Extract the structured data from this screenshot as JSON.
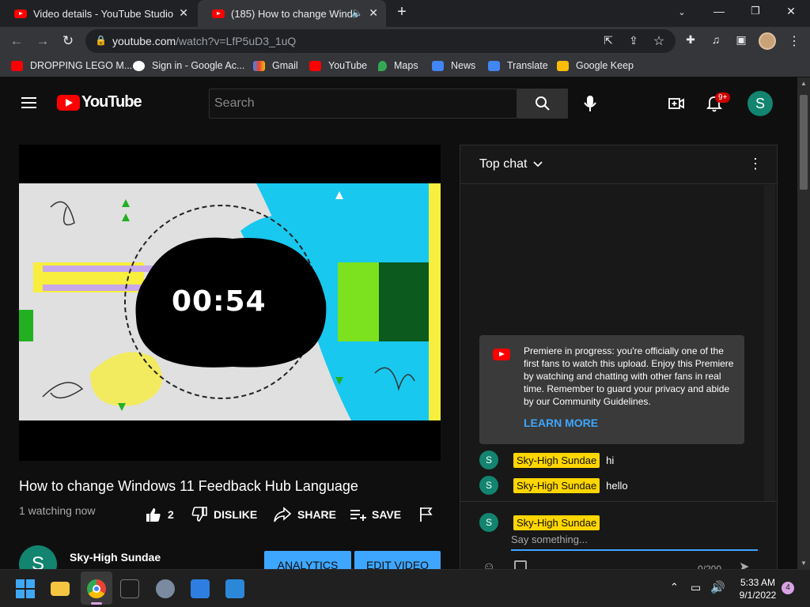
{
  "browser": {
    "tabs": [
      {
        "title": "Video details - YouTube Studio",
        "active": false
      },
      {
        "title": "(185) How to change Windo",
        "active": true
      }
    ],
    "url_host": "youtube.com",
    "url_path": "/watch?v=LfP5uD3_1uQ",
    "bookmarks": [
      "DROPPING LEGO M...",
      "Sign in - Google Ac...",
      "Gmail",
      "YouTube",
      "Maps",
      "News",
      "Translate",
      "Google Keep"
    ]
  },
  "youtube": {
    "logo_text": "YouTube",
    "search_placeholder": "Search",
    "notification_badge": "9+",
    "user_initial": "S"
  },
  "video": {
    "countdown": "00:54",
    "title": "How to change Windows 11 Feedback Hub Language",
    "watching": "1 watching now",
    "like_count": "2",
    "dislike_label": "DISLIKE",
    "share_label": "SHARE",
    "save_label": "SAVE",
    "channel_name": "Sky-High Sundae",
    "channel_initial": "S",
    "analytics_label": "ANALYTICS",
    "edit_label": "EDIT VIDEO"
  },
  "chat": {
    "header": "Top chat",
    "premiere_text": "Premiere in progress: you're officially one of the first fans to watch this upload. Enjoy this Premiere by watching and chatting with other fans in real time. Remember to guard your privacy and abide by our Community Guidelines.",
    "learn_more": "LEARN MORE",
    "messages": [
      {
        "author": "Sky-High Sundae",
        "initial": "S",
        "text": "hi"
      },
      {
        "author": "Sky-High Sundae",
        "initial": "S",
        "text": "hello"
      }
    ],
    "input_author": "Sky-High Sundae",
    "input_initial": "S",
    "input_placeholder": "Say something...",
    "char_count": "0/200"
  },
  "taskbar": {
    "time": "5:33 AM",
    "date": "9/1/2022",
    "notification_count": "4"
  },
  "colors": {
    "yt_red": "#ff0000",
    "avatar_teal": "#128470",
    "badge_yellow": "#ffd600",
    "link_blue": "#3ea6ff",
    "button_blue": "#3ea6ff"
  }
}
